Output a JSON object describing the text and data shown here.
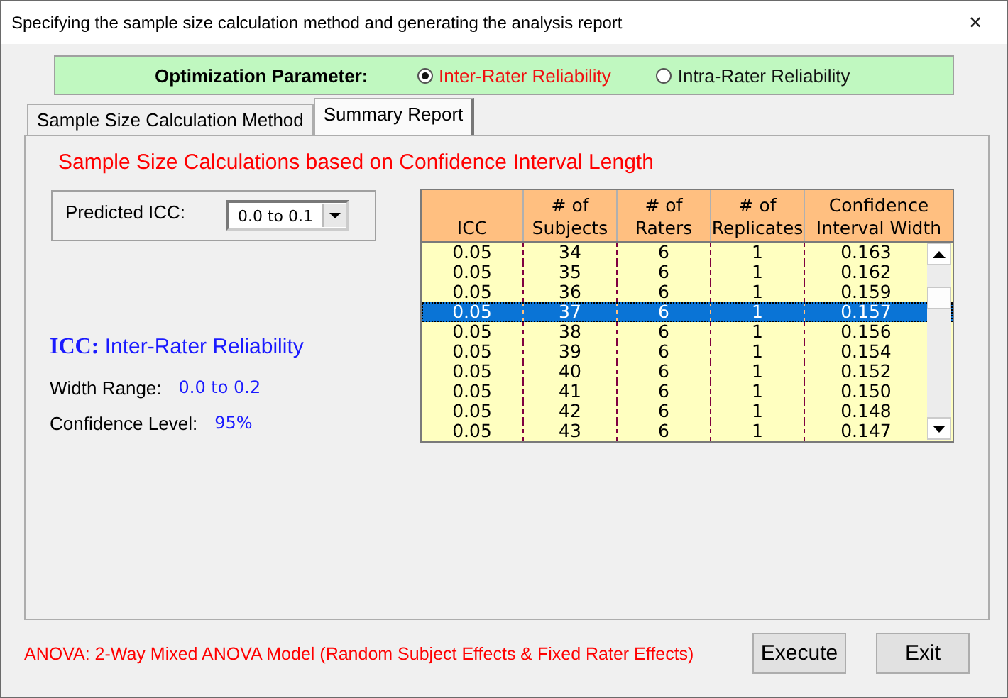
{
  "window": {
    "title": "Specifying the sample size calculation method and generating the analysis report",
    "close": "✕"
  },
  "optimization": {
    "label": "Optimization Parameter:",
    "options": [
      {
        "label": "Inter-Rater Reliability",
        "selected": true
      },
      {
        "label": "Intra-Rater Reliability",
        "selected": false
      }
    ]
  },
  "tabs": [
    {
      "label": "Sample Size Calculation Method",
      "selected": false
    },
    {
      "label": "Summary Report",
      "selected": true
    }
  ],
  "report": {
    "heading": "Sample Size Calculations based on Confidence Interval Length",
    "predicted_icc": {
      "label": "Predicted ICC:",
      "value": "0.0 to 0.1"
    },
    "icc": {
      "label": "ICC:",
      "value": "Inter-Rater Reliability"
    },
    "width_range": {
      "label": "Width Range:",
      "value": "0.0 to 0.2"
    },
    "confidence_level": {
      "label": "Confidence Level:",
      "value": "95%"
    },
    "table": {
      "columns": [
        "ICC",
        "# of\nSubjects",
        "# of\nRaters",
        "# of\nReplicates",
        "Confidence\nInterval Width"
      ],
      "rows": [
        {
          "cells": [
            "0.05",
            "34",
            "6",
            "1",
            "0.163"
          ],
          "selected": false
        },
        {
          "cells": [
            "0.05",
            "35",
            "6",
            "1",
            "0.162"
          ],
          "selected": false
        },
        {
          "cells": [
            "0.05",
            "36",
            "6",
            "1",
            "0.159"
          ],
          "selected": false
        },
        {
          "cells": [
            "0.05",
            "37",
            "6",
            "1",
            "0.157"
          ],
          "selected": true
        },
        {
          "cells": [
            "0.05",
            "38",
            "6",
            "1",
            "0.156"
          ],
          "selected": false
        },
        {
          "cells": [
            "0.05",
            "39",
            "6",
            "1",
            "0.154"
          ],
          "selected": false
        },
        {
          "cells": [
            "0.05",
            "40",
            "6",
            "1",
            "0.152"
          ],
          "selected": false
        },
        {
          "cells": [
            "0.05",
            "41",
            "6",
            "1",
            "0.150"
          ],
          "selected": false
        },
        {
          "cells": [
            "0.05",
            "42",
            "6",
            "1",
            "0.148"
          ],
          "selected": false
        },
        {
          "cells": [
            "0.05",
            "43",
            "6",
            "1",
            "0.147"
          ],
          "selected": false
        }
      ]
    }
  },
  "footer": {
    "model": "ANOVA: 2-Way Mixed ANOVA Model (Random Subject Effects & Fixed Rater Effects)",
    "buttons": [
      "Execute",
      "Exit"
    ]
  }
}
